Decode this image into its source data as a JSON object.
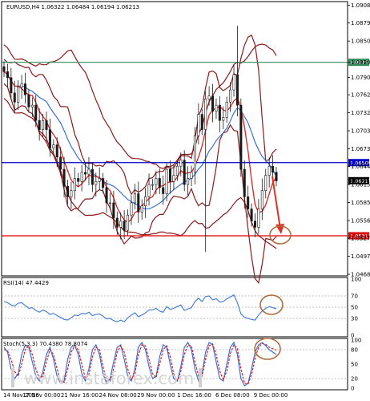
{
  "header": {
    "symbol_line": "EURUSD,H4  1.06322 1.06484 1.06194 1.06213"
  },
  "watermark": "www.instaforex.com",
  "chart_data": {
    "type": "candlestick",
    "symbol": "EURUSD",
    "timeframe": "H4",
    "ohlc_header": {
      "open": 1.06322,
      "high": 1.06484,
      "low": 1.06194,
      "close": 1.06213
    },
    "price_axis": {
      "ticks": [
        1.09085,
        1.08798,
        1.085,
        1.08152,
        1.07905,
        1.0762,
        1.07325,
        1.0703,
        1.06735,
        1.06445,
        1.0615,
        1.05855,
        1.0556,
        1.0527,
        1.04975,
        1.0468
      ],
      "tick_labels": [
        "1.09085",
        "1.08798",
        "1.08500",
        "1.08205",
        "1.07905",
        "1.07620",
        "1.07325",
        "1.07030",
        "1.06735",
        "1.06445",
        "1.06150",
        "1.05855",
        "1.05560",
        "1.05270",
        "1.04975",
        "1.04680"
      ],
      "range": [
        1.0468,
        1.0912
      ]
    },
    "levels": [
      {
        "price": 1.08152,
        "label": "1.08152",
        "color": "#2e8b57"
      },
      {
        "price": 1.06509,
        "label": "1.06509",
        "color": "#0000cc"
      },
      {
        "price": 1.06213,
        "label": "1.06213",
        "color": "#000000"
      },
      {
        "price": 1.05311,
        "label": "1.05311",
        "color": "#dd0000"
      }
    ],
    "time_labels": [
      "14 Nov 2016",
      "17 Nov 00:00",
      "21 Nov 16:00",
      "24 Nov 08:00",
      "29 Nov 00:00",
      "1 Dec 16:00",
      "6 Dec 08:00",
      "9 Dec 00:00"
    ],
    "closes": [
      1.08,
      1.079,
      1.0765,
      1.075,
      1.0775,
      1.078,
      1.0762,
      1.0742,
      1.0745,
      1.072,
      1.0705,
      1.072,
      1.0705,
      1.0675,
      1.068,
      1.066,
      1.064,
      1.0612,
      1.0595,
      1.0605,
      1.0625,
      1.062,
      1.0635,
      1.0632,
      1.064,
      1.0615,
      1.062,
      1.0625,
      1.061,
      1.0585,
      1.0585,
      1.056,
      1.0545,
      1.0555,
      1.054,
      1.0565,
      1.0585,
      1.06,
      1.057,
      1.058,
      1.0595,
      1.0615,
      1.0615,
      1.0625,
      1.061,
      1.06,
      1.064,
      1.062,
      1.063,
      1.0645,
      1.0655,
      1.0615,
      1.0625,
      1.0635,
      1.0695,
      1.073,
      1.0705,
      1.0755,
      1.076,
      1.0735,
      1.0745,
      1.072,
      1.0725,
      1.075,
      1.077,
      1.0795,
      1.0745,
      1.064,
      1.0595,
      1.0575,
      1.0555,
      1.0545,
      1.0575,
      1.0605,
      1.063,
      1.0645,
      1.0635,
      1.0621
    ],
    "rsi": {
      "label": "RSI(14) 47.4429",
      "period": 14,
      "last": 47.4429,
      "levels": [
        70,
        50,
        30
      ],
      "level_labels": [
        "100",
        "70",
        "50",
        "30",
        "0"
      ],
      "values": [
        60,
        58,
        54,
        52,
        57,
        58,
        53,
        48,
        49,
        44,
        41,
        45,
        42,
        37,
        39,
        35,
        32,
        28,
        27,
        31,
        36,
        35,
        39,
        38,
        41,
        35,
        37,
        38,
        34,
        29,
        30,
        26,
        24,
        27,
        24,
        31,
        36,
        40,
        33,
        36,
        40,
        45,
        45,
        48,
        43,
        41,
        51,
        46,
        48,
        51,
        54,
        44,
        47,
        49,
        60,
        66,
        60,
        69,
        70,
        63,
        65,
        59,
        60,
        65,
        68,
        72,
        58,
        38,
        32,
        30,
        28,
        27,
        36,
        43,
        48,
        51,
        49,
        47.4
      ]
    },
    "stoch": {
      "label": "Stoch(5,3,3) 70.4380 78.8074",
      "params": [
        5,
        3,
        3
      ],
      "main_last": 70.438,
      "signal_last": 78.8074,
      "level_labels": [
        "100",
        "80",
        "50",
        "20",
        "0"
      ],
      "main": [
        85,
        75,
        40,
        20,
        30,
        70,
        90,
        85,
        55,
        25,
        15,
        35,
        70,
        85,
        60,
        25,
        10,
        15,
        60,
        85,
        90,
        70,
        30,
        15,
        40,
        80,
        90,
        70,
        30,
        10,
        20,
        55,
        85,
        90,
        60,
        25,
        15,
        40,
        85,
        95,
        80,
        45,
        20,
        25,
        65,
        90,
        85,
        50,
        20,
        15,
        45,
        85,
        95,
        80,
        40,
        15,
        30,
        75,
        95,
        90,
        55,
        20,
        15,
        50,
        85,
        95,
        70,
        20,
        5,
        10,
        40,
        75,
        90,
        95,
        88,
        80,
        75,
        70
      ],
      "signal": [
        80,
        78,
        60,
        35,
        25,
        50,
        80,
        88,
        70,
        40,
        20,
        25,
        55,
        80,
        70,
        40,
        15,
        12,
        40,
        75,
        88,
        80,
        50,
        20,
        28,
        65,
        85,
        80,
        45,
        15,
        15,
        40,
        75,
        88,
        75,
        40,
        18,
        30,
        70,
        90,
        88,
        60,
        30,
        22,
        50,
        80,
        88,
        65,
        30,
        15,
        35,
        70,
        90,
        88,
        55,
        25,
        25,
        60,
        88,
        92,
        70,
        35,
        18,
        35,
        72,
        90,
        82,
        40,
        10,
        8,
        28,
        62,
        85,
        93,
        91,
        85,
        82,
        79
      ]
    }
  }
}
